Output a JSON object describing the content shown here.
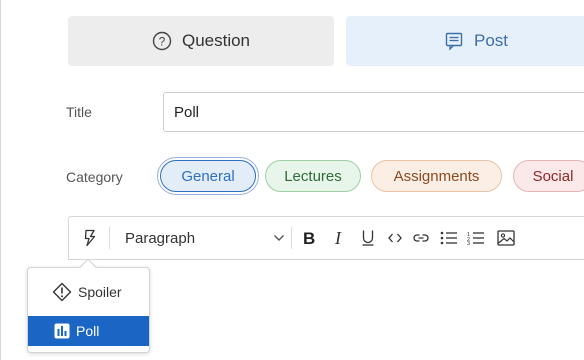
{
  "post_type": {
    "question_label": "Question",
    "post_label": "Post",
    "selected": "Post"
  },
  "title_row": {
    "label": "Title",
    "value": "Poll"
  },
  "category_row": {
    "label": "Category",
    "chips": [
      {
        "label": "General",
        "selected": true
      },
      {
        "label": "Lectures",
        "selected": false
      },
      {
        "label": "Assignments",
        "selected": false
      },
      {
        "label": "Social",
        "selected": false
      }
    ]
  },
  "toolbar": {
    "block_format": "Paragraph",
    "tools": [
      "insert-menu-icon",
      "bold-icon",
      "italic-icon",
      "underline-icon",
      "code-icon",
      "link-icon",
      "bullet-list-icon",
      "numbered-list-icon",
      "image-icon"
    ]
  },
  "insert_menu": {
    "items": [
      {
        "label": "Spoiler",
        "icon": "spoiler-icon",
        "highlighted": false
      },
      {
        "label": "Poll",
        "icon": "poll-icon",
        "highlighted": true
      }
    ]
  },
  "colors": {
    "accent": "#2f6fbf",
    "highlight": "#1b65c4",
    "post_selected_bg": "#e6f0fb"
  }
}
